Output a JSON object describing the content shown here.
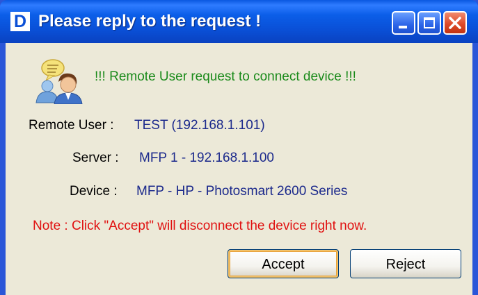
{
  "window": {
    "title": "Please reply to the request !",
    "app_icon_letter": "D",
    "controls": [
      "minimize",
      "maximize",
      "close"
    ]
  },
  "message": {
    "headline": "!!! Remote User request to connect device !!!",
    "icon": "users-chat-icon"
  },
  "fields": {
    "remote_user_label": "Remote User :",
    "remote_user_value": "TEST (192.168.1.101)",
    "server_label": "Server :",
    "server_value": "MFP 1 - 192.168.1.100",
    "device_label": "Device :",
    "device_value": "MFP - HP - Photosmart 2600 Series"
  },
  "note": "Note : Click \"Accept\" will disconnect the device right now.",
  "buttons": {
    "accept": "Accept",
    "reject": "Reject"
  },
  "colors": {
    "titlebar": "#0a4fd6",
    "headline": "#1a8a1a",
    "value_text": "#1c2a8c",
    "note": "#e01010",
    "dialog_bg": "#ece9d8",
    "close_button": "#de4a2a"
  }
}
